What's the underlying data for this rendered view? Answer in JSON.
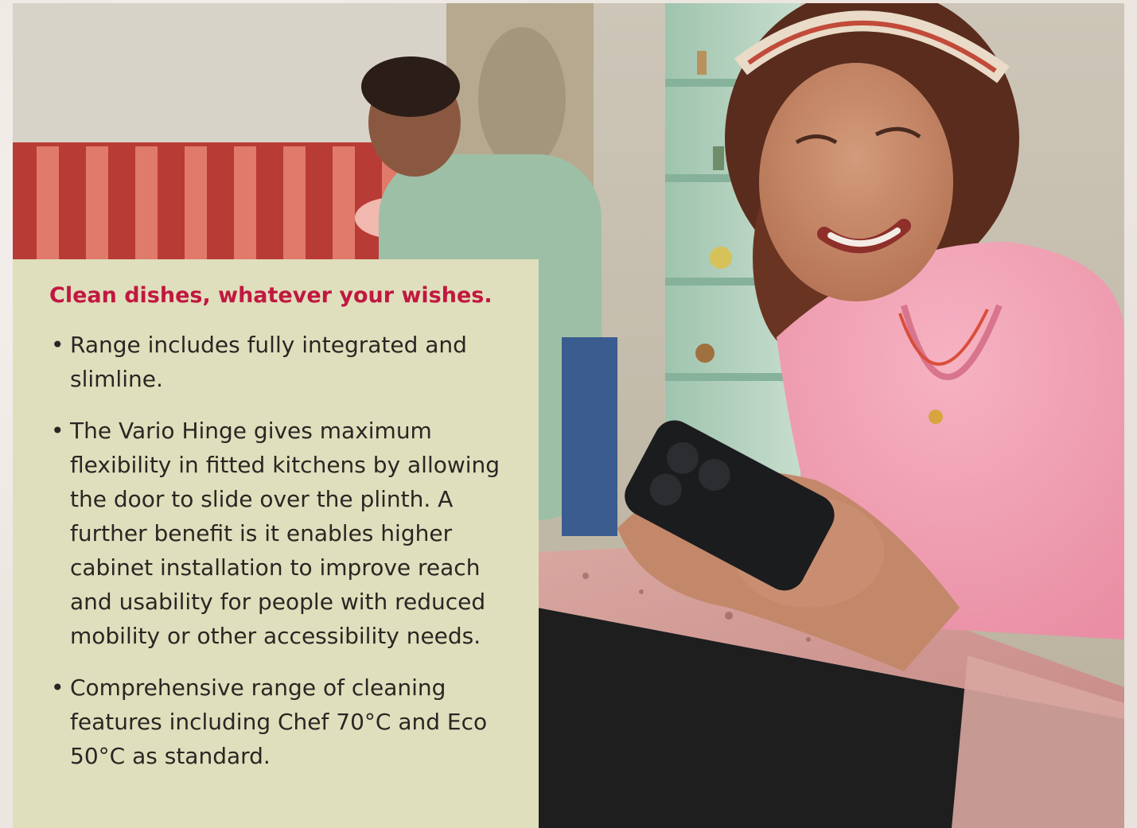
{
  "panel": {
    "heading": "Clean dishes, whatever your wishes.",
    "bullets": [
      {
        "marker": "•",
        "text": "Range includes fully integrated and slimline."
      },
      {
        "marker": "•",
        "text": "The Vario Hinge gives maximum flexibility in fitted kitchens by allowing the door to slide over the plinth. A further benefit is it enables higher cabinet installation to improve reach and usability for people with reduced mobility or other accessibility needs."
      },
      {
        "marker": "•",
        "text": "Comprehensive range of cleaning features including Chef 70°C and Eco 50°C as standard."
      }
    ]
  },
  "colors": {
    "heading": "#c01840",
    "panel_background": "#e0dfbd",
    "body_text": "#2a2623"
  }
}
